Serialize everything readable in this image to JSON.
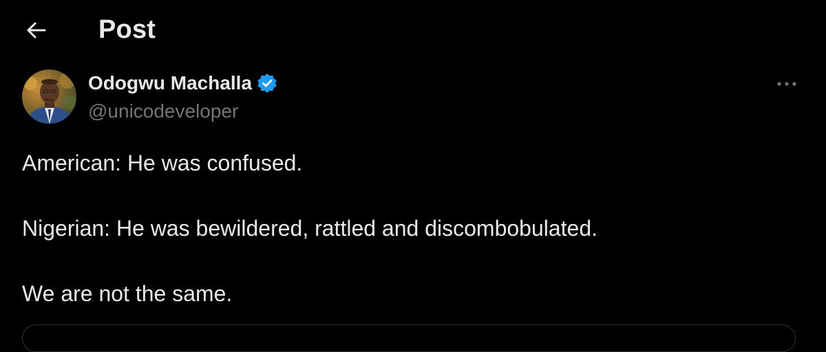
{
  "header": {
    "back_icon": "arrow-left-icon",
    "title": "Post"
  },
  "author": {
    "name": "Odogwu Machalla",
    "handle": "@unicodeveloper",
    "verified": true,
    "verified_icon": "verified-badge-icon",
    "verified_color": "#1d9bf0"
  },
  "more_icon": "more-horizontal-icon",
  "tweet": {
    "lines": [
      "American: He was confused.",
      "Nigerian: He was bewildered, rattled and discombobulated.",
      "We are not the same."
    ]
  },
  "colors": {
    "background": "#000000",
    "text_primary": "#e7e9ea",
    "text_secondary": "#71767b",
    "border": "#2f3336"
  }
}
